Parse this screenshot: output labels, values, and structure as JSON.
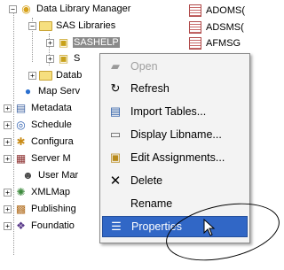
{
  "tree": {
    "root": {
      "label": "Data Library Manager",
      "icon": "data-library-manager-icon"
    },
    "sas_libraries": {
      "label": "SAS Libraries"
    },
    "sashelp": {
      "label": "SASHELP"
    },
    "s_item": {
      "label": "S"
    },
    "datab": {
      "label": "Datab"
    },
    "items": [
      {
        "label": "Map Serv",
        "icon": "map-services-icon"
      },
      {
        "label": "Metadata",
        "icon": "metadata-icon"
      },
      {
        "label": "Schedule",
        "icon": "schedule-icon"
      },
      {
        "label": "Configura",
        "icon": "configuration-icon"
      },
      {
        "label": "Server M",
        "icon": "server-manager-icon"
      },
      {
        "label": "User Mar",
        "icon": "user-manager-icon"
      },
      {
        "label": "XMLMap",
        "icon": "xmlmap-icon"
      },
      {
        "label": "Publishing",
        "icon": "publishing-icon"
      },
      {
        "label": "Foundatio",
        "icon": "foundation-icon"
      }
    ]
  },
  "tables": [
    {
      "label": "ADOMS("
    },
    {
      "label": "ADSMS("
    },
    {
      "label": "AFMSG"
    }
  ],
  "context_menu": {
    "items": [
      {
        "label": "Open",
        "icon": "folder-open-icon",
        "disabled": true
      },
      {
        "label": "Refresh",
        "icon": "refresh-icon"
      },
      {
        "label": "Import Tables...",
        "icon": "import-tables-icon"
      },
      {
        "label": "Display Libname...",
        "icon": "display-libname-icon"
      },
      {
        "label": "Edit Assignments...",
        "icon": "edit-assignments-icon"
      },
      {
        "label": "Delete",
        "icon": "delete-icon"
      },
      {
        "label": "Rename",
        "icon": ""
      },
      {
        "label": "Properties",
        "icon": "properties-icon",
        "highlighted": true
      }
    ]
  },
  "colors": {
    "highlight": "#3167c6",
    "selection": "#8a8a8a",
    "folder": "#f6df7f"
  }
}
